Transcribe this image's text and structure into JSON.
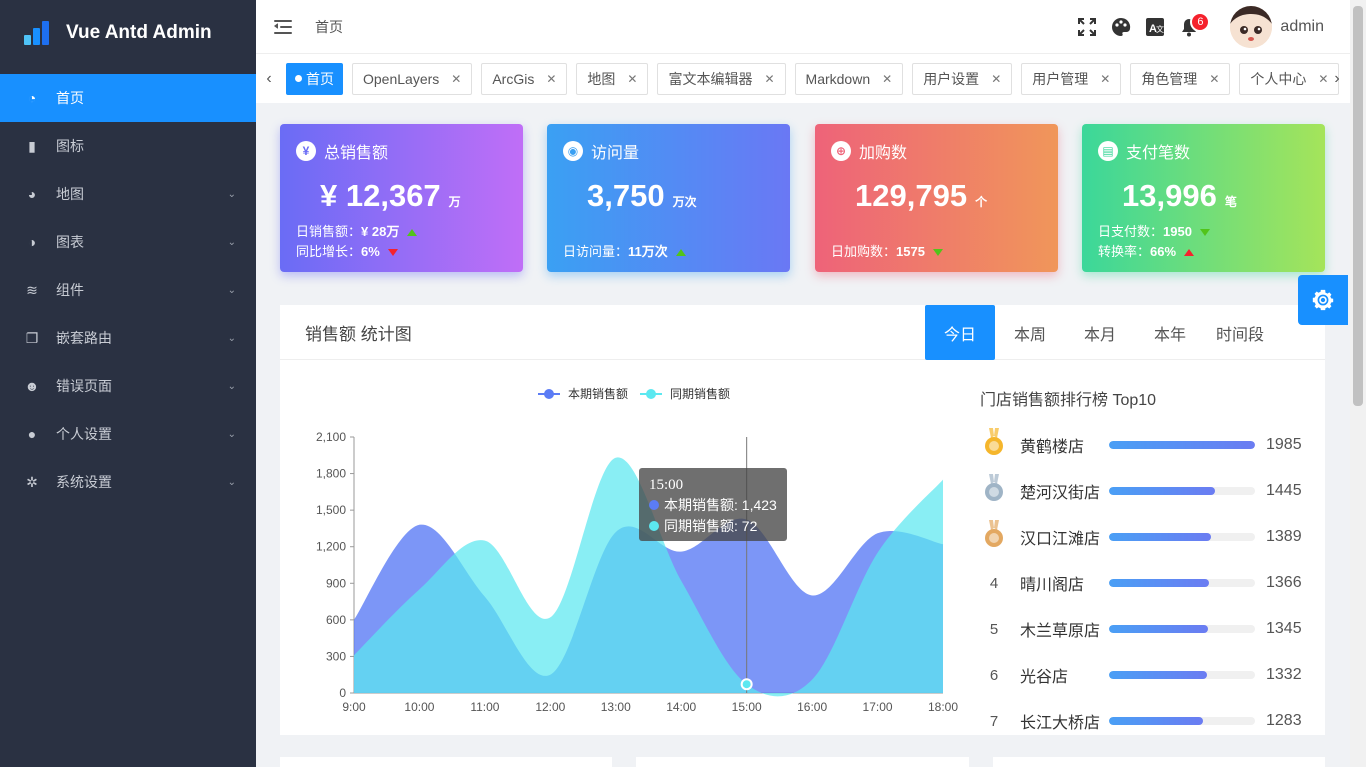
{
  "app": {
    "title": "Vue Antd Admin"
  },
  "sidebar": {
    "items": [
      {
        "label": "首页",
        "icon": "dashboard-icon",
        "active": true,
        "expandable": false
      },
      {
        "label": "图标",
        "icon": "icon-font-icon",
        "active": false,
        "expandable": false
      },
      {
        "label": "地图",
        "icon": "globe-icon",
        "active": false,
        "expandable": true
      },
      {
        "label": "图表",
        "icon": "pie-chart-icon",
        "active": false,
        "expandable": true
      },
      {
        "label": "组件",
        "icon": "layers-icon",
        "active": false,
        "expandable": true
      },
      {
        "label": "嵌套路由",
        "icon": "copy-icon",
        "active": false,
        "expandable": true
      },
      {
        "label": "错误页面",
        "icon": "robot-icon",
        "active": false,
        "expandable": true
      },
      {
        "label": "个人设置",
        "icon": "user-icon",
        "active": false,
        "expandable": true
      },
      {
        "label": "系统设置",
        "icon": "gear-icon",
        "active": false,
        "expandable": true
      }
    ]
  },
  "header": {
    "breadcrumb": "首页",
    "notification_count": "6",
    "username": "admin"
  },
  "tabs": [
    {
      "label": "首页",
      "active": true
    },
    {
      "label": "OpenLayers",
      "active": false
    },
    {
      "label": "ArcGis",
      "active": false
    },
    {
      "label": "地图",
      "active": false
    },
    {
      "label": "富文本编辑器",
      "active": false
    },
    {
      "label": "Markdown",
      "active": false
    },
    {
      "label": "用户设置",
      "active": false
    },
    {
      "label": "用户管理",
      "active": false
    },
    {
      "label": "角色管理",
      "active": false
    },
    {
      "label": "个人中心",
      "active": false
    }
  ],
  "cards": [
    {
      "title": "总销售额",
      "icon_glyph": "¥",
      "value": "¥ 12,367",
      "unit": "万",
      "lines": [
        {
          "label": "日销售额：",
          "value": "¥ 28万",
          "trend": "up"
        },
        {
          "label": "同比增长：",
          "value": "6%",
          "trend": "down"
        }
      ],
      "gradient": [
        "#6a6cf5",
        "#c06ef7"
      ]
    },
    {
      "title": "访问量",
      "icon_glyph": "◉",
      "value": "3,750",
      "unit": "万次",
      "lines": [
        {
          "label": "日访问量：",
          "value": "11万次",
          "trend": "up"
        }
      ],
      "gradient": [
        "#3aa0f3",
        "#6a78f4"
      ]
    },
    {
      "title": "加购数",
      "icon_glyph": "⊕",
      "value": "129,795",
      "unit": "个",
      "lines": [
        {
          "label": "日加购数：",
          "value": "1575",
          "trend": "down-green"
        }
      ],
      "gradient": [
        "#ee6379",
        "#f0965a"
      ]
    },
    {
      "title": "支付笔数",
      "icon_glyph": "▤",
      "value": "13,996",
      "unit": "笔",
      "lines": [
        {
          "label": "日支付数：",
          "value": "1950",
          "trend": "down-green"
        },
        {
          "label": "转换率：",
          "value": "66%",
          "trend": "up-red"
        }
      ],
      "gradient": [
        "#3bd79a",
        "#a5e45a"
      ]
    }
  ],
  "sales_panel": {
    "title": "销售额 统计图",
    "period_tabs": [
      {
        "label": "今日",
        "active": true
      },
      {
        "label": "本周",
        "active": false
      },
      {
        "label": "本月",
        "active": false
      },
      {
        "label": "本年",
        "active": false
      },
      {
        "label": "时间段",
        "active": false
      }
    ]
  },
  "chart_data": {
    "type": "area",
    "x": [
      "9:00",
      "10:00",
      "11:00",
      "12:00",
      "13:00",
      "14:00",
      "15:00",
      "16:00",
      "17:00",
      "18:00"
    ],
    "series": [
      {
        "name": "本期销售额",
        "color": "#5b7cf5",
        "values": [
          600,
          1380,
          790,
          150,
          1320,
          1160,
          1423,
          800,
          1310,
          1220
        ]
      },
      {
        "name": "同期销售额",
        "color": "#5ce8f0",
        "values": [
          310,
          850,
          1250,
          620,
          1930,
          920,
          72,
          110,
          1150,
          1750
        ]
      }
    ],
    "ylim": [
      0,
      2100
    ],
    "yticks": [
      "0",
      "300",
      "600",
      "900",
      "1,200",
      "1,500",
      "1,800",
      "2,100"
    ],
    "legend": "top-center",
    "tooltip": {
      "title": "15:00",
      "lines": [
        "本期销售额: 1,423",
        "同期销售额: 72"
      ]
    }
  },
  "ranking": {
    "title": "门店销售额排行榜 Top10",
    "max": 1985,
    "items": [
      {
        "rank": "1",
        "name": "黄鹤楼店",
        "value": 1985,
        "medal": "gold"
      },
      {
        "rank": "2",
        "name": "楚河汉街店",
        "value": 1445,
        "medal": "silver"
      },
      {
        "rank": "3",
        "name": "汉口江滩店",
        "value": 1389,
        "medal": "bronze"
      },
      {
        "rank": "4",
        "name": "晴川阁店",
        "value": 1366
      },
      {
        "rank": "5",
        "name": "木兰草原店",
        "value": 1345
      },
      {
        "rank": "6",
        "name": "光谷店",
        "value": 1332
      },
      {
        "rank": "7",
        "name": "长江大桥店",
        "value": 1283
      }
    ]
  }
}
